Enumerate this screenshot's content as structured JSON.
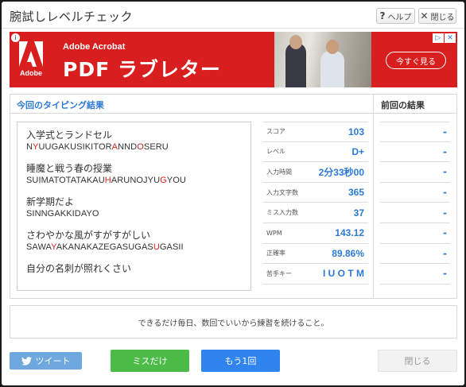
{
  "window": {
    "title": "腕試しレベルチェック",
    "help_label": "ヘルプ",
    "close_label": "閉じる"
  },
  "ad": {
    "brand": "Adobe Acrobat",
    "product": "PDF ラブレター",
    "logo_text": "Adobe",
    "cta": "今すぐ見る",
    "brand_color": "#d81e1e"
  },
  "result": {
    "current_header": "今回のタイピング結果",
    "previous_header": "前回の結果",
    "lines": [
      {
        "japanese": "入学式とランドセル",
        "romaji": [
          {
            "t": "N"
          },
          {
            "t": "Y",
            "miss": true
          },
          {
            "t": "UUGAKUSIKITOR"
          },
          {
            "t": "A",
            "miss": true
          },
          {
            "t": "NND"
          },
          {
            "t": "O",
            "miss": true
          },
          {
            "t": "SERU"
          }
        ]
      },
      {
        "japanese": "睡魔と戦う春の授業",
        "romaji": [
          {
            "t": "SUIMATOTATAKAU"
          },
          {
            "t": "H",
            "miss": true
          },
          {
            "t": "ARUNOJYU"
          },
          {
            "t": "G",
            "miss": true
          },
          {
            "t": "YOU"
          }
        ]
      },
      {
        "japanese": "新学期だよ",
        "romaji": [
          {
            "t": "SINNGAKKIDAYO"
          }
        ]
      },
      {
        "japanese": "さわやかな風がすがすがしい",
        "romaji": [
          {
            "t": "SAWA"
          },
          {
            "t": "Y",
            "miss": true
          },
          {
            "t": "AKANAKAZEGASUGAS"
          },
          {
            "t": "U",
            "miss": true
          },
          {
            "t": "GASII"
          }
        ]
      },
      {
        "japanese": "自分の名刺が照れくさい",
        "romaji": []
      }
    ],
    "stats": [
      {
        "label": "スコア",
        "value": "103",
        "previous": "-"
      },
      {
        "label": "レベル",
        "value": "D+",
        "previous": "-"
      },
      {
        "label": "入力時間",
        "value": "2分33秒00",
        "previous": "-"
      },
      {
        "label": "入力文字数",
        "value": "365",
        "previous": "-"
      },
      {
        "label": "ミス入力数",
        "value": "37",
        "previous": "-"
      },
      {
        "label": "WPM",
        "value": "143.12",
        "previous": "-"
      },
      {
        "label": "正確率",
        "value": "89.86%",
        "previous": "-"
      },
      {
        "label": "苦手キー",
        "value": "I U O T M",
        "previous": "-"
      }
    ]
  },
  "advice": "できるだけ毎日、数回でいいから練習を続けること。",
  "buttons": {
    "tweet": "ツイート",
    "miss_only": "ミスだけ",
    "retry": "もう1回",
    "close": "閉じる"
  },
  "colors": {
    "accent": "#2c7ad6",
    "miss": "#e02020",
    "green": "#4cbb47",
    "blue": "#2f84ee",
    "twitter": "#6fa8de"
  }
}
